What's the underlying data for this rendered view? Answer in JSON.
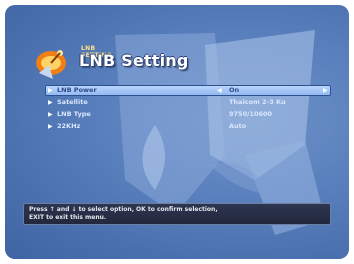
{
  "title": "LNB Setting",
  "title_small": "LNB SETTING",
  "menu_items": [
    {
      "label": "LNB Power",
      "value": "On",
      "selected": true
    },
    {
      "label": "Satellite",
      "value": "Thaicom 2-3 Ku",
      "selected": false
    },
    {
      "label": "LNB Type",
      "value": "9750/10600",
      "selected": false
    },
    {
      "label": "22KHz",
      "value": "Auto",
      "selected": false
    }
  ],
  "help": "Press ↑ and ↓ to select option, OK to confirm selection,\nEXIT to exit this menu.",
  "icons": {
    "logo": "satellite-dish-icon",
    "bullet": "triangle-right-icon",
    "left_arrow": "triangle-left-icon",
    "right_arrow": "triangle-right-icon"
  },
  "colors": {
    "screen_bg": "#4a6fae",
    "selected_row": "#a6c6f5",
    "help_bg": "#262d45",
    "title_text": "#ffffff"
  }
}
